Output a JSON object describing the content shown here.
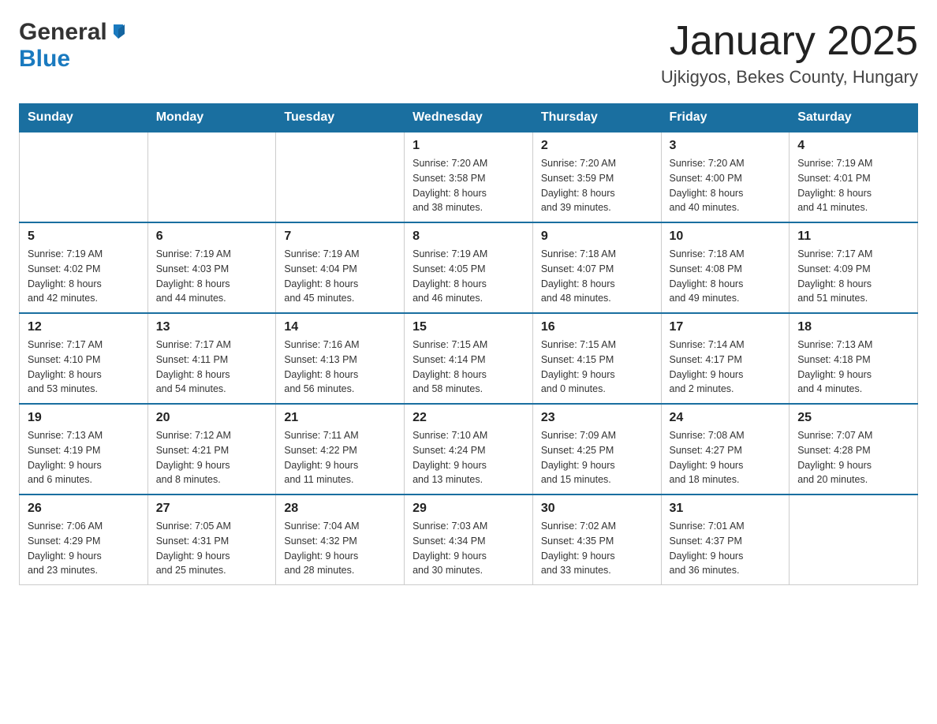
{
  "header": {
    "logo_general": "General",
    "logo_blue": "Blue",
    "title": "January 2025",
    "location": "Ujkigyos, Bekes County, Hungary"
  },
  "days_of_week": [
    "Sunday",
    "Monday",
    "Tuesday",
    "Wednesday",
    "Thursday",
    "Friday",
    "Saturday"
  ],
  "weeks": [
    [
      {
        "day": "",
        "info": ""
      },
      {
        "day": "",
        "info": ""
      },
      {
        "day": "",
        "info": ""
      },
      {
        "day": "1",
        "info": "Sunrise: 7:20 AM\nSunset: 3:58 PM\nDaylight: 8 hours\nand 38 minutes."
      },
      {
        "day": "2",
        "info": "Sunrise: 7:20 AM\nSunset: 3:59 PM\nDaylight: 8 hours\nand 39 minutes."
      },
      {
        "day": "3",
        "info": "Sunrise: 7:20 AM\nSunset: 4:00 PM\nDaylight: 8 hours\nand 40 minutes."
      },
      {
        "day": "4",
        "info": "Sunrise: 7:19 AM\nSunset: 4:01 PM\nDaylight: 8 hours\nand 41 minutes."
      }
    ],
    [
      {
        "day": "5",
        "info": "Sunrise: 7:19 AM\nSunset: 4:02 PM\nDaylight: 8 hours\nand 42 minutes."
      },
      {
        "day": "6",
        "info": "Sunrise: 7:19 AM\nSunset: 4:03 PM\nDaylight: 8 hours\nand 44 minutes."
      },
      {
        "day": "7",
        "info": "Sunrise: 7:19 AM\nSunset: 4:04 PM\nDaylight: 8 hours\nand 45 minutes."
      },
      {
        "day": "8",
        "info": "Sunrise: 7:19 AM\nSunset: 4:05 PM\nDaylight: 8 hours\nand 46 minutes."
      },
      {
        "day": "9",
        "info": "Sunrise: 7:18 AM\nSunset: 4:07 PM\nDaylight: 8 hours\nand 48 minutes."
      },
      {
        "day": "10",
        "info": "Sunrise: 7:18 AM\nSunset: 4:08 PM\nDaylight: 8 hours\nand 49 minutes."
      },
      {
        "day": "11",
        "info": "Sunrise: 7:17 AM\nSunset: 4:09 PM\nDaylight: 8 hours\nand 51 minutes."
      }
    ],
    [
      {
        "day": "12",
        "info": "Sunrise: 7:17 AM\nSunset: 4:10 PM\nDaylight: 8 hours\nand 53 minutes."
      },
      {
        "day": "13",
        "info": "Sunrise: 7:17 AM\nSunset: 4:11 PM\nDaylight: 8 hours\nand 54 minutes."
      },
      {
        "day": "14",
        "info": "Sunrise: 7:16 AM\nSunset: 4:13 PM\nDaylight: 8 hours\nand 56 minutes."
      },
      {
        "day": "15",
        "info": "Sunrise: 7:15 AM\nSunset: 4:14 PM\nDaylight: 8 hours\nand 58 minutes."
      },
      {
        "day": "16",
        "info": "Sunrise: 7:15 AM\nSunset: 4:15 PM\nDaylight: 9 hours\nand 0 minutes."
      },
      {
        "day": "17",
        "info": "Sunrise: 7:14 AM\nSunset: 4:17 PM\nDaylight: 9 hours\nand 2 minutes."
      },
      {
        "day": "18",
        "info": "Sunrise: 7:13 AM\nSunset: 4:18 PM\nDaylight: 9 hours\nand 4 minutes."
      }
    ],
    [
      {
        "day": "19",
        "info": "Sunrise: 7:13 AM\nSunset: 4:19 PM\nDaylight: 9 hours\nand 6 minutes."
      },
      {
        "day": "20",
        "info": "Sunrise: 7:12 AM\nSunset: 4:21 PM\nDaylight: 9 hours\nand 8 minutes."
      },
      {
        "day": "21",
        "info": "Sunrise: 7:11 AM\nSunset: 4:22 PM\nDaylight: 9 hours\nand 11 minutes."
      },
      {
        "day": "22",
        "info": "Sunrise: 7:10 AM\nSunset: 4:24 PM\nDaylight: 9 hours\nand 13 minutes."
      },
      {
        "day": "23",
        "info": "Sunrise: 7:09 AM\nSunset: 4:25 PM\nDaylight: 9 hours\nand 15 minutes."
      },
      {
        "day": "24",
        "info": "Sunrise: 7:08 AM\nSunset: 4:27 PM\nDaylight: 9 hours\nand 18 minutes."
      },
      {
        "day": "25",
        "info": "Sunrise: 7:07 AM\nSunset: 4:28 PM\nDaylight: 9 hours\nand 20 minutes."
      }
    ],
    [
      {
        "day": "26",
        "info": "Sunrise: 7:06 AM\nSunset: 4:29 PM\nDaylight: 9 hours\nand 23 minutes."
      },
      {
        "day": "27",
        "info": "Sunrise: 7:05 AM\nSunset: 4:31 PM\nDaylight: 9 hours\nand 25 minutes."
      },
      {
        "day": "28",
        "info": "Sunrise: 7:04 AM\nSunset: 4:32 PM\nDaylight: 9 hours\nand 28 minutes."
      },
      {
        "day": "29",
        "info": "Sunrise: 7:03 AM\nSunset: 4:34 PM\nDaylight: 9 hours\nand 30 minutes."
      },
      {
        "day": "30",
        "info": "Sunrise: 7:02 AM\nSunset: 4:35 PM\nDaylight: 9 hours\nand 33 minutes."
      },
      {
        "day": "31",
        "info": "Sunrise: 7:01 AM\nSunset: 4:37 PM\nDaylight: 9 hours\nand 36 minutes."
      },
      {
        "day": "",
        "info": ""
      }
    ]
  ]
}
